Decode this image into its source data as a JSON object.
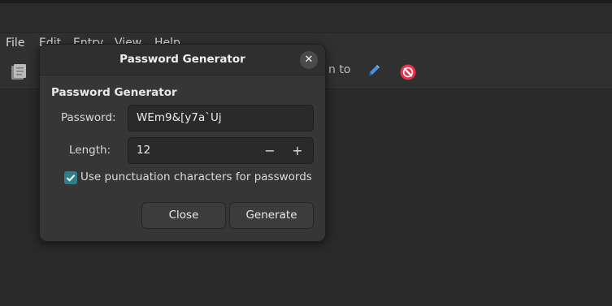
{
  "menubar": {
    "items": [
      "File",
      "Edit",
      "Entry",
      "View",
      "Help"
    ]
  },
  "toolbar": {
    "partial_text": "n to",
    "icons": [
      "document-icon",
      "pencil-icon",
      "no-entry-icon"
    ],
    "colors": {
      "pencil": "#4a8fe0",
      "no_entry": "#e8324a"
    }
  },
  "dialog": {
    "title": "Password Generator",
    "section_title": "Password Generator",
    "password_label": "Password:",
    "password_value": "WEm9&[y7a`Uj",
    "length_label": "Length:",
    "length_value": "12",
    "spin_minus": "−",
    "spin_plus": "+",
    "punctuation_label": "Use punctuation characters for passwords",
    "punctuation_checked": true,
    "close_button": "Close",
    "generate_button": "Generate",
    "accent_color": "#2f7f8a"
  }
}
